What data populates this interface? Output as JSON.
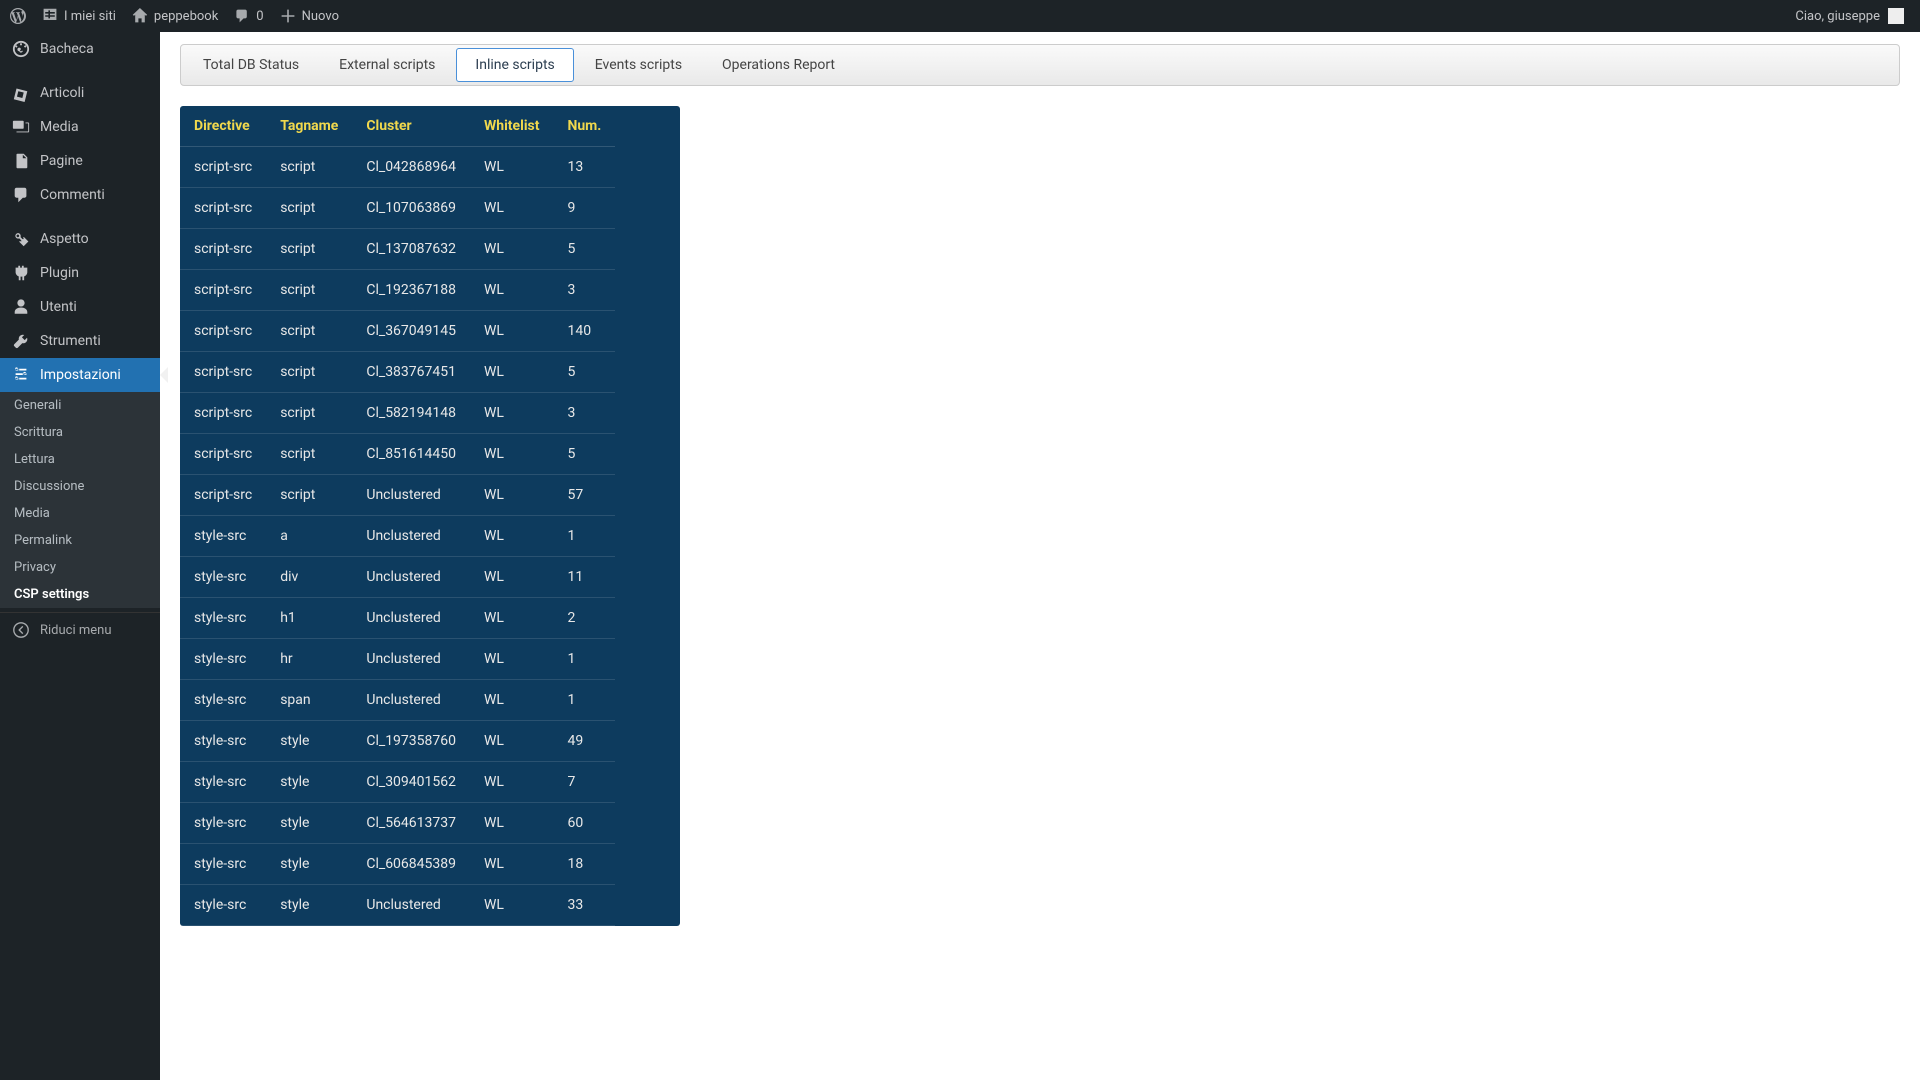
{
  "adminBar": {
    "mySites": "I miei siti",
    "siteName": "peppebook",
    "comments": "0",
    "new": "Nuovo",
    "greeting": "Ciao, giuseppe"
  },
  "sidebar": {
    "items": [
      {
        "label": "Bacheca"
      },
      {
        "label": "Articoli"
      },
      {
        "label": "Media"
      },
      {
        "label": "Pagine"
      },
      {
        "label": "Commenti"
      },
      {
        "label": "Aspetto"
      },
      {
        "label": "Plugin"
      },
      {
        "label": "Utenti"
      },
      {
        "label": "Strumenti"
      },
      {
        "label": "Impostazioni"
      }
    ],
    "submenu": [
      {
        "label": "Generali"
      },
      {
        "label": "Scrittura"
      },
      {
        "label": "Lettura"
      },
      {
        "label": "Discussione"
      },
      {
        "label": "Media"
      },
      {
        "label": "Permalink"
      },
      {
        "label": "Privacy"
      },
      {
        "label": "CSP settings"
      }
    ],
    "collapse": "Riduci menu"
  },
  "tabs": [
    "Total DB Status",
    "External scripts",
    "Inline scripts",
    "Events scripts",
    "Operations Report"
  ],
  "activeTab": 2,
  "table": {
    "headers": [
      "Directive",
      "Tagname",
      "Cluster",
      "Whitelist",
      "Num."
    ],
    "rows": [
      [
        "script-src",
        "script",
        "Cl_042868964",
        "WL",
        "13"
      ],
      [
        "script-src",
        "script",
        "Cl_107063869",
        "WL",
        "9"
      ],
      [
        "script-src",
        "script",
        "Cl_137087632",
        "WL",
        "5"
      ],
      [
        "script-src",
        "script",
        "Cl_192367188",
        "WL",
        "3"
      ],
      [
        "script-src",
        "script",
        "Cl_367049145",
        "WL",
        "140"
      ],
      [
        "script-src",
        "script",
        "Cl_383767451",
        "WL",
        "5"
      ],
      [
        "script-src",
        "script",
        "Cl_582194148",
        "WL",
        "3"
      ],
      [
        "script-src",
        "script",
        "Cl_851614450",
        "WL",
        "5"
      ],
      [
        "script-src",
        "script",
        "Unclustered",
        "WL",
        "57"
      ],
      [
        "style-src",
        "a",
        "Unclustered",
        "WL",
        "1"
      ],
      [
        "style-src",
        "div",
        "Unclustered",
        "WL",
        "11"
      ],
      [
        "style-src",
        "h1",
        "Unclustered",
        "WL",
        "2"
      ],
      [
        "style-src",
        "hr",
        "Unclustered",
        "WL",
        "1"
      ],
      [
        "style-src",
        "span",
        "Unclustered",
        "WL",
        "1"
      ],
      [
        "style-src",
        "style",
        "Cl_197358760",
        "WL",
        "49"
      ],
      [
        "style-src",
        "style",
        "Cl_309401562",
        "WL",
        "7"
      ],
      [
        "style-src",
        "style",
        "Cl_564613737",
        "WL",
        "60"
      ],
      [
        "style-src",
        "style",
        "Cl_606845389",
        "WL",
        "18"
      ],
      [
        "style-src",
        "style",
        "Unclustered",
        "WL",
        "33"
      ]
    ]
  }
}
